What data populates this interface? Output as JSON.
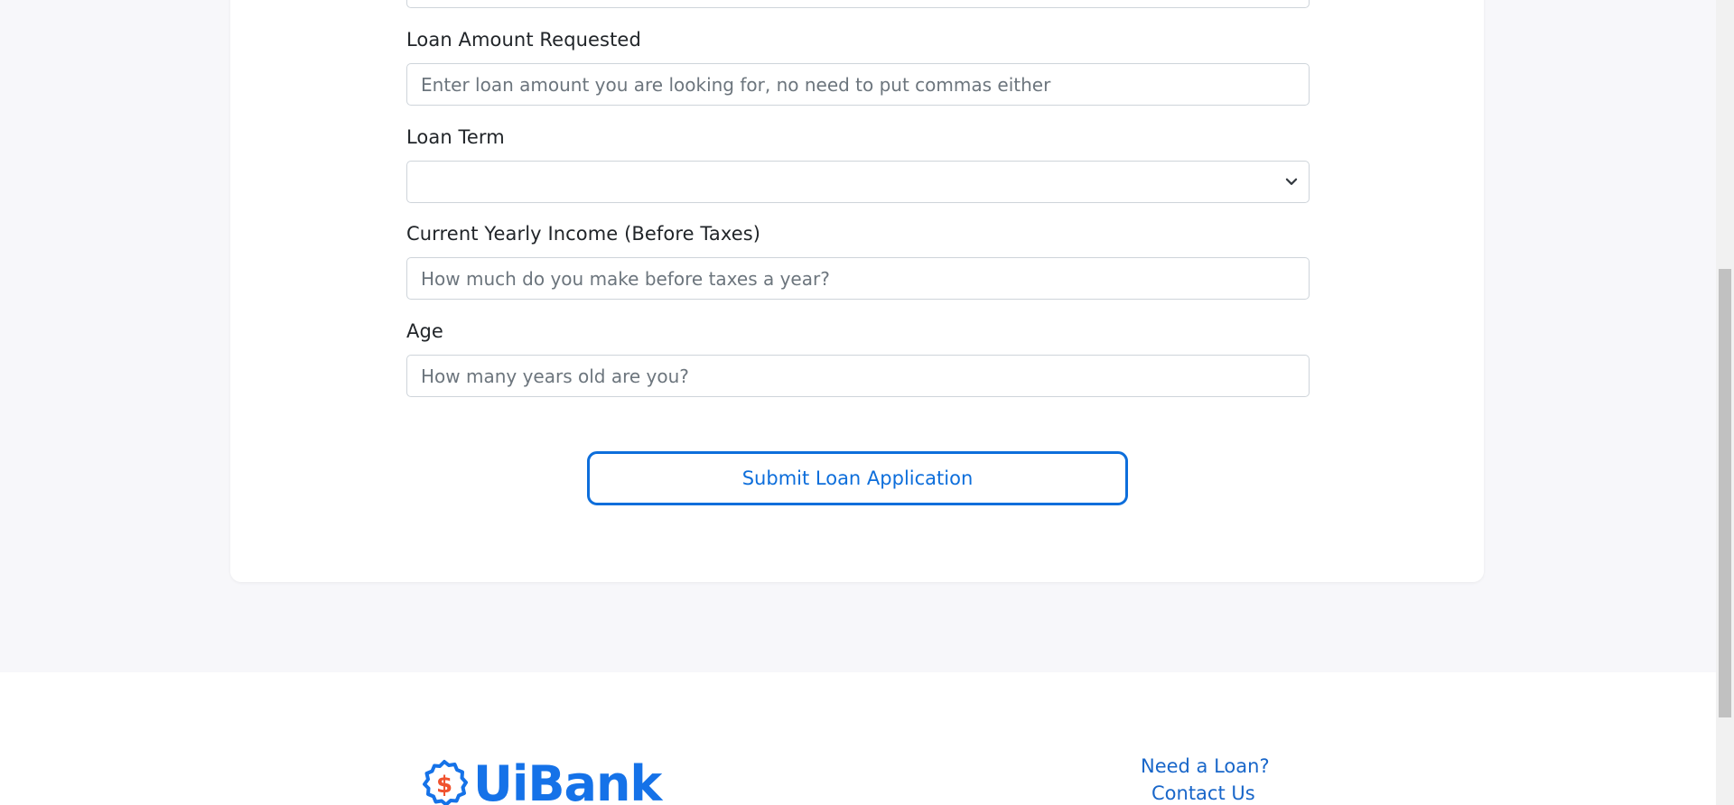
{
  "form": {
    "loan_amount": {
      "label": "Loan Amount Requested",
      "placeholder": "Enter loan amount you are looking for, no need to put commas either",
      "value": ""
    },
    "loan_term": {
      "label": "Loan Term",
      "selected": ""
    },
    "yearly_income": {
      "label": "Current Yearly Income (Before Taxes)",
      "placeholder": "How much do you make before taxes a year?",
      "value": ""
    },
    "age": {
      "label": "Age",
      "placeholder": "How many years old are you?",
      "value": ""
    },
    "submit_label": "Submit Loan Application"
  },
  "footer": {
    "logo_text": "UiBank",
    "links": {
      "need_loan": "Need a Loan?",
      "contact_us": "Contact Us"
    }
  },
  "colors": {
    "accent": "#0d6edb",
    "brand_blue": "#1572e8",
    "brand_orange": "#f0522e",
    "page_bg": "#f7f7fa"
  },
  "icons": {
    "select_arrow": "chevron-down-icon",
    "logo_badge": "dollar-badge-icon"
  }
}
